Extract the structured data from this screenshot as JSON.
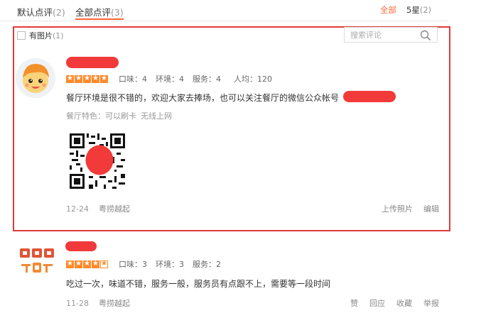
{
  "tabs": [
    {
      "label": "默认点评",
      "count": "(2)"
    },
    {
      "label": "全部点评",
      "count": "(3)"
    }
  ],
  "filters": {
    "all": "全部",
    "five_star": "5星",
    "five_star_count": "(2)"
  },
  "photo_filter": {
    "label": "有图片",
    "count": "(1)"
  },
  "search": {
    "placeholder": "搜索评论"
  },
  "review1": {
    "stars": 5,
    "scores": [
      "口味：4",
      "环境：4",
      "服务：4",
      "人均：120"
    ],
    "text": "餐厅环境是很不错的，欢迎大家去捧场，也可以关注餐厅的微信公众帐号",
    "tags_label": "餐厅特色：",
    "tags": [
      "可以刷卡",
      "无线上网"
    ],
    "date": "12-24",
    "shop": "粤捞越起",
    "actions": [
      "上传照片",
      "编辑"
    ],
    "colors": {
      "highlight_border": "#e03a3a",
      "star": "#ff8a2a",
      "redaction": "#f23a3a"
    }
  },
  "review2": {
    "stars": 4,
    "scores": [
      "口味：3",
      "环境：3",
      "服务：2"
    ],
    "text": "吃过一次，味道不错，服务一般，服务员有点跟不上，需要等一段时间",
    "date": "11-28",
    "shop": "粤捞越起",
    "actions": [
      "赞",
      "回应",
      "收藏",
      "举报"
    ]
  },
  "accent_color": "#ff6633"
}
